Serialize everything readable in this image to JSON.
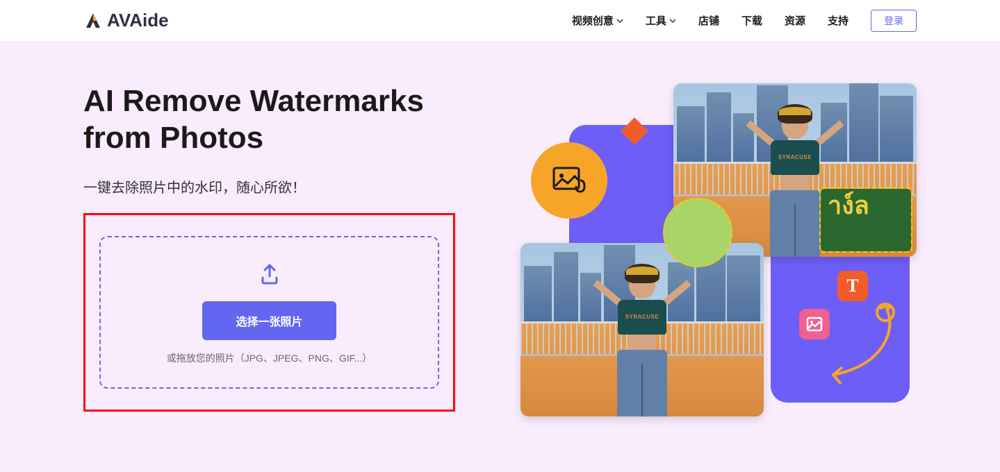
{
  "brand": {
    "name": "AVAide"
  },
  "nav": {
    "items": [
      {
        "label": "视频创意",
        "hasDropdown": true
      },
      {
        "label": "工具",
        "hasDropdown": true
      },
      {
        "label": "店铺",
        "hasDropdown": false
      },
      {
        "label": "下载",
        "hasDropdown": false
      },
      {
        "label": "资源",
        "hasDropdown": false
      },
      {
        "label": "支持",
        "hasDropdown": false
      }
    ],
    "login": "登录"
  },
  "hero": {
    "title_line1": "AI Remove Watermarks",
    "title_line2": "from Photos",
    "subtitle": "一键去除照片中的水印，随心所欲！",
    "select_button": "选择一张照片",
    "drop_hint": "或拖放您的照片（JPG、JPEG、PNG、GIF...）"
  },
  "preview": {
    "shirt_text": "SYRACUSE",
    "watermark_sample": "าง์ล",
    "text_icon_letter": "T"
  }
}
